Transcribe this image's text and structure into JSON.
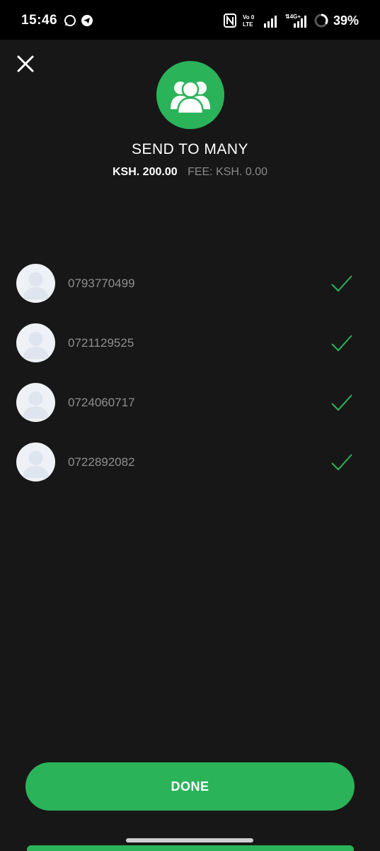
{
  "status_bar": {
    "time": "15:46",
    "network_label": "Vo LTE",
    "signal_label": "4G+",
    "battery": "39%"
  },
  "header": {
    "title": "SEND TO MANY",
    "amount": "KSH. 200.00",
    "fee": "FEE: KSH. 0.00"
  },
  "recipients": [
    {
      "phone": "0793770499"
    },
    {
      "phone": "0721129525"
    },
    {
      "phone": "0724060717"
    },
    {
      "phone": "0722892082"
    }
  ],
  "actions": {
    "done_label": "DONE"
  },
  "colors": {
    "accent": "#2bb35a",
    "background": "#171717"
  }
}
